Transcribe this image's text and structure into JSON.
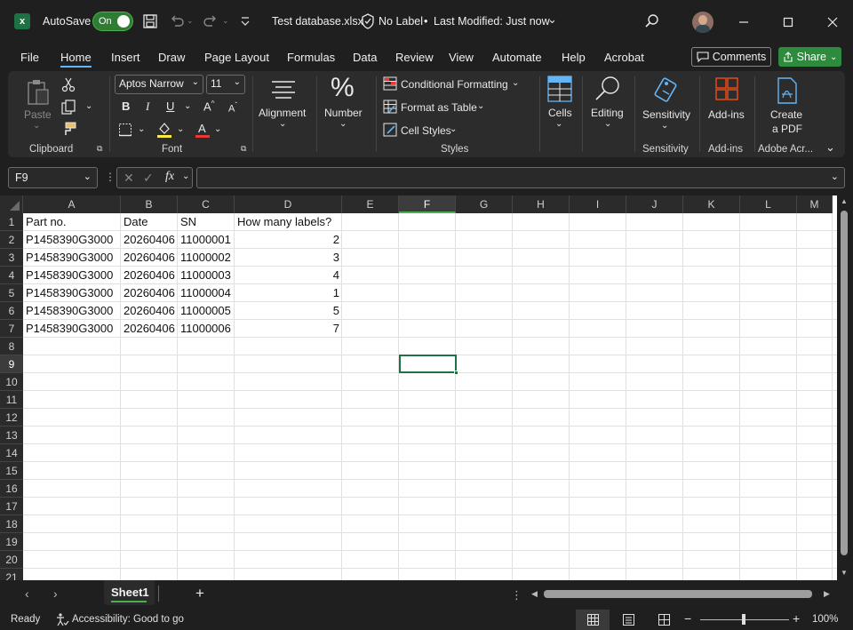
{
  "titlebar": {
    "autosave_label": "AutoSave",
    "autosave_state": "On",
    "filename": "Test database.xlsx",
    "label_status": "No Label",
    "modified": "Last Modified: Just now"
  },
  "menu": {
    "tabs": [
      "File",
      "Home",
      "Insert",
      "Draw",
      "Page Layout",
      "Formulas",
      "Data",
      "Review",
      "View",
      "Automate",
      "Help",
      "Acrobat"
    ],
    "active": "Home",
    "comments_label": "Comments",
    "share_label": "Share"
  },
  "ribbon": {
    "paste_label": "Paste",
    "clipboard_group": "Clipboard",
    "font_name": "Aptos Narrow",
    "font_size": "11",
    "font_group": "Font",
    "alignment_label": "Alignment",
    "number_label": "Number",
    "conditional_formatting": "Conditional Formatting",
    "format_as_table": "Format as Table",
    "cell_styles": "Cell Styles",
    "styles_group": "Styles",
    "cells_label": "Cells",
    "editing_label": "Editing",
    "sensitivity_label": "Sensitivity",
    "sensitivity_group": "Sensitivity",
    "addins_label": "Add-ins",
    "addins_group": "Add-ins",
    "create_pdf_line1": "Create",
    "create_pdf_line2": "a PDF",
    "adobe_group": "Adobe Acr..."
  },
  "formula_bar": {
    "name_box": "F9",
    "formula": ""
  },
  "sheet": {
    "columns": [
      "A",
      "B",
      "C",
      "D",
      "E",
      "F",
      "G",
      "H",
      "I",
      "J",
      "K",
      "L",
      "M"
    ],
    "selected_column": "F",
    "selected_row": "9",
    "rows": [
      "1",
      "2",
      "3",
      "4",
      "5",
      "6",
      "7",
      "8",
      "9",
      "10",
      "11",
      "12",
      "13",
      "14",
      "15",
      "16",
      "17",
      "18",
      "19",
      "20",
      "21"
    ],
    "headers": [
      "Part no.",
      "Date",
      "SN",
      "How many labels?"
    ],
    "data": [
      [
        "P1458390G3000",
        "20260406",
        "11000001",
        "2"
      ],
      [
        "P1458390G3000",
        "20260406",
        "11000002",
        "3"
      ],
      [
        "P1458390G3000",
        "20260406",
        "11000003",
        "4"
      ],
      [
        "P1458390G3000",
        "20260406",
        "11000004",
        "1"
      ],
      [
        "P1458390G3000",
        "20260406",
        "11000005",
        "5"
      ],
      [
        "P1458390G3000",
        "20260406",
        "11000006",
        "7"
      ]
    ]
  },
  "tabs": {
    "sheet_name": "Sheet1",
    "add_label": "+"
  },
  "status": {
    "ready": "Ready",
    "accessibility": "Accessibility: Good to go",
    "zoom": "100%"
  },
  "colors": {
    "accent_green": "#1e7145",
    "share_green": "#2e8a3c",
    "font_color_red": "#e53935",
    "highlight_yellow": "#ffeb3b"
  }
}
